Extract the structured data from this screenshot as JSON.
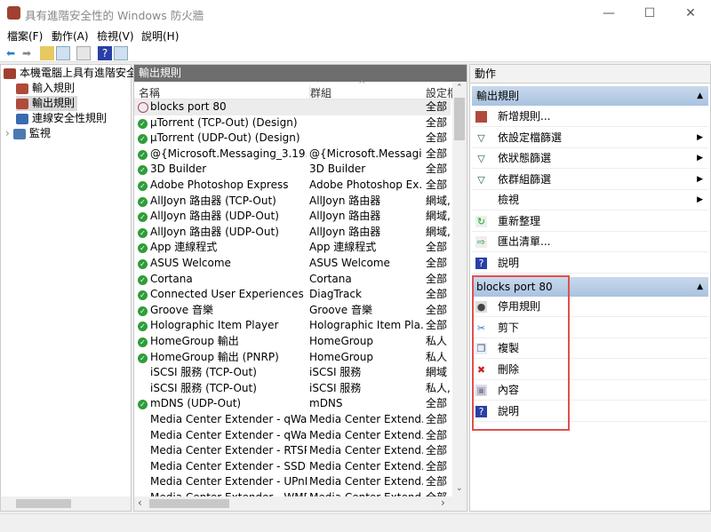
{
  "window": {
    "title": "具有進階安全性的 Windows 防火牆",
    "minimize": "—",
    "maximize": "☐",
    "close": "✕"
  },
  "menu": [
    "檔案(F)",
    "動作(A)",
    "檢視(V)",
    "說明(H)"
  ],
  "tree": {
    "root": "本機電腦上具有進階安全",
    "items": [
      "輸入規則",
      "輸出規則",
      "連線安全性規則",
      "監視"
    ]
  },
  "list": {
    "title": "輸出規則",
    "columns": [
      "名稱",
      "群組",
      "設定檔"
    ],
    "rows": [
      {
        "name": "blocks port 80",
        "group": "",
        "profile": "全部",
        "status": "blocked"
      },
      {
        "name": "µTorrent (TCP-Out) (Design)",
        "group": "",
        "profile": "全部",
        "status": "enabled"
      },
      {
        "name": "µTorrent (UDP-Out) (Design)",
        "group": "",
        "profile": "全部",
        "status": "enabled"
      },
      {
        "name": "@{Microsoft.Messaging_3.19.1...",
        "group": "@{Microsoft.Messagi...",
        "profile": "全部",
        "status": "enabled"
      },
      {
        "name": "3D Builder",
        "group": "3D Builder",
        "profile": "全部",
        "status": "enabled"
      },
      {
        "name": "Adobe Photoshop Express",
        "group": "Adobe Photoshop Ex...",
        "profile": "全部",
        "status": "enabled"
      },
      {
        "name": "AllJoyn 路由器 (TCP-Out)",
        "group": "AllJoyn 路由器",
        "profile": "網域, ...",
        "status": "enabled"
      },
      {
        "name": "AllJoyn 路由器 (UDP-Out)",
        "group": "AllJoyn 路由器",
        "profile": "網域, ...",
        "status": "enabled"
      },
      {
        "name": "AllJoyn 路由器 (UDP-Out)",
        "group": "AllJoyn 路由器",
        "profile": "網域, ...",
        "status": "enabled"
      },
      {
        "name": "App 連線程式",
        "group": "App 連線程式",
        "profile": "全部",
        "status": "enabled"
      },
      {
        "name": "ASUS Welcome",
        "group": "ASUS Welcome",
        "profile": "全部",
        "status": "enabled"
      },
      {
        "name": "Cortana",
        "group": "Cortana",
        "profile": "全部",
        "status": "enabled"
      },
      {
        "name": "Connected User Experiences an...",
        "group": "DiagTrack",
        "profile": "全部",
        "status": "enabled"
      },
      {
        "name": "Groove 音樂",
        "group": "Groove 音樂",
        "profile": "全部",
        "status": "enabled"
      },
      {
        "name": "Holographic Item Player",
        "group": "Holographic Item Pla...",
        "profile": "全部",
        "status": "enabled"
      },
      {
        "name": "HomeGroup 輸出",
        "group": "HomeGroup",
        "profile": "私人",
        "status": "enabled"
      },
      {
        "name": "HomeGroup 輸出 (PNRP)",
        "group": "HomeGroup",
        "profile": "私人",
        "status": "enabled"
      },
      {
        "name": "iSCSI 服務 (TCP-Out)",
        "group": "iSCSI 服務",
        "profile": "網域",
        "status": "none"
      },
      {
        "name": "iSCSI 服務 (TCP-Out)",
        "group": "iSCSI 服務",
        "profile": "私人, ...",
        "status": "none"
      },
      {
        "name": "mDNS (UDP-Out)",
        "group": "mDNS",
        "profile": "全部",
        "status": "enabled"
      },
      {
        "name": "Media Center Extender - qWav...",
        "group": "Media Center Extend...",
        "profile": "全部",
        "status": "none"
      },
      {
        "name": "Media Center Extender - qWav...",
        "group": "Media Center Extend...",
        "profile": "全部",
        "status": "none"
      },
      {
        "name": "Media Center Extender - RTSP ...",
        "group": "Media Center Extend...",
        "profile": "全部",
        "status": "none"
      },
      {
        "name": "Media Center Extender - SSDP ...",
        "group": "Media Center Extend...",
        "profile": "全部",
        "status": "none"
      },
      {
        "name": "Media Center Extender - UPnP ...",
        "group": "Media Center Extend...",
        "profile": "全部",
        "status": "none"
      },
      {
        "name": "Media Center Extender - WMD...",
        "group": "Media Center Extend...",
        "profile": "全部",
        "status": "none"
      }
    ]
  },
  "actions": {
    "title": "動作",
    "section1": {
      "title": "輸出規則",
      "items": [
        {
          "label": "新增規則...",
          "icon": "new-rule-icon",
          "sub": false
        },
        {
          "label": "依設定檔篩選",
          "icon": "filter-icon",
          "sub": true
        },
        {
          "label": "依狀態篩選",
          "icon": "filter-icon",
          "sub": true
        },
        {
          "label": "依群組篩選",
          "icon": "filter-icon",
          "sub": true
        },
        {
          "label": "檢視",
          "icon": "",
          "sub": true
        },
        {
          "label": "重新整理",
          "icon": "refresh-icon",
          "sub": false
        },
        {
          "label": "匯出清單...",
          "icon": "export-icon",
          "sub": false
        },
        {
          "label": "說明",
          "icon": "help-icon",
          "sub": false
        }
      ]
    },
    "section2": {
      "title": "blocks port 80",
      "items": [
        {
          "label": "停用規則",
          "icon": "disable-rule-icon"
        },
        {
          "label": "剪下",
          "icon": "cut-icon"
        },
        {
          "label": "複製",
          "icon": "copy-icon"
        },
        {
          "label": "刪除",
          "icon": "delete-icon"
        },
        {
          "label": "內容",
          "icon": "properties-icon"
        },
        {
          "label": "說明",
          "icon": "help-icon"
        }
      ]
    }
  }
}
